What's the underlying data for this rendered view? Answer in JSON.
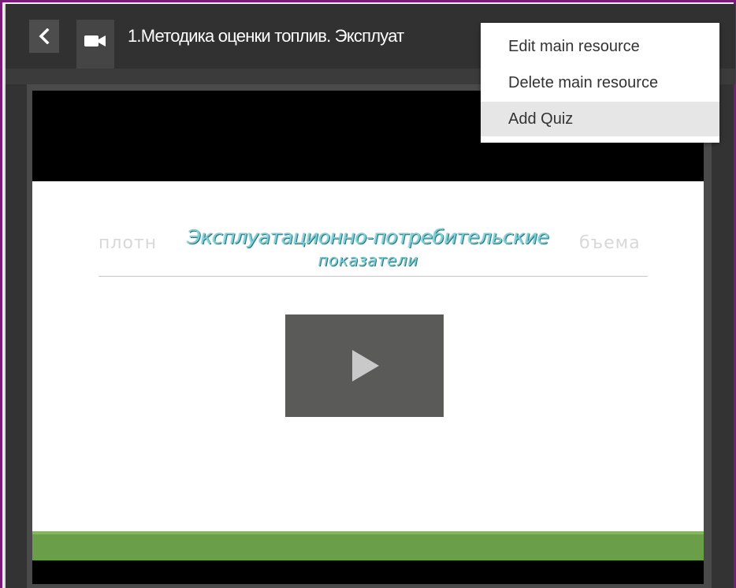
{
  "header": {
    "title": "1.Методика оценки топлив. Эксплуат",
    "back_icon": "chevron-left-icon",
    "resource_icon": "video-camera-icon"
  },
  "menu": {
    "items": [
      {
        "label": "Edit main resource"
      },
      {
        "label": "Delete main resource"
      },
      {
        "label": "Add Quiz"
      }
    ]
  },
  "slide": {
    "ghost_left": "плотн",
    "ghost_right": "бъема",
    "heading_line1": "Эксплуатационно-потребительские",
    "heading_line2": "показатели",
    "play_icon": "play-icon"
  },
  "colors": {
    "frame_border": "#7a1a7a",
    "topbar": "#313131",
    "accent_green": "#6a9e48",
    "heading_text": "#7ad0d6"
  }
}
